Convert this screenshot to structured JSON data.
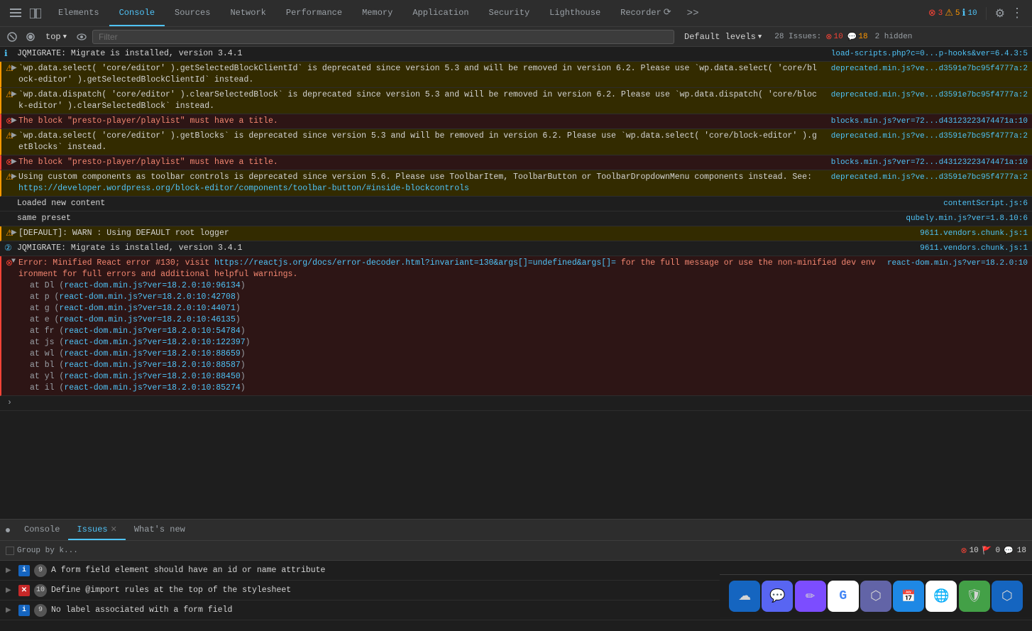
{
  "devtools": {
    "tabs": [
      {
        "id": "elements",
        "label": "Elements",
        "active": false
      },
      {
        "id": "console",
        "label": "Console",
        "active": true
      },
      {
        "id": "sources",
        "label": "Sources",
        "active": false
      },
      {
        "id": "network",
        "label": "Network",
        "active": false
      },
      {
        "id": "performance",
        "label": "Performance",
        "active": false
      },
      {
        "id": "memory",
        "label": "Memory",
        "active": false
      },
      {
        "id": "application",
        "label": "Application",
        "active": false
      },
      {
        "id": "security",
        "label": "Security",
        "active": false
      },
      {
        "id": "lighthouse",
        "label": "Lighthouse",
        "active": false
      },
      {
        "id": "recorder",
        "label": "Recorder",
        "active": false
      }
    ],
    "error_count": "3",
    "warn_count": "5",
    "info_count": "10"
  },
  "toolbar": {
    "top_label": "top",
    "filter_placeholder": "Filter",
    "default_levels": "Default levels",
    "issues_label": "28 Issues:",
    "issues_error": "10",
    "issues_warn": "18",
    "hidden": "2 hidden"
  },
  "console_entries": [
    {
      "id": "jq1",
      "type": "info",
      "message": "JQMIGRATE: Migrate is installed, version 3.4.1",
      "source": "load-scripts.php?c=0...p-hooks&ver=6.4.3:5"
    },
    {
      "id": "warn1",
      "type": "warning",
      "message": "`wp.data.select( 'core/editor' ).getSelectedBlockClientId` is deprecated since version 5.3 and will be removed in version 6.2. Please use `wp.data.select( 'core/block-editor' ).getSelectedBlockClientId` instead.",
      "source": "deprecated.min.js?ve...d3591e7bc95f4777a:2"
    },
    {
      "id": "warn2",
      "type": "warning",
      "message": "`wp.data.dispatch( 'core/editor' ).clearSelectedBlock` is deprecated since version 5.3 and will be removed in version 6.2. Please use `wp.data.dispatch( 'core/block-editor' ).clearSelectedBlock` instead.",
      "source": "deprecated.min.js?ve...d3591e7bc95f4777a:2"
    },
    {
      "id": "err1",
      "type": "error",
      "message": "The block \"presto-player/playlist\" must have a title.",
      "source": "blocks.min.js?ver=72...d43123223474471a:10"
    },
    {
      "id": "warn3",
      "type": "warning",
      "message": "`wp.data.select( 'core/editor' ).getBlocks` is deprecated since version 5.3 and will be removed in version 6.2. Please use `wp.data.select( 'core/block-editor' ).getBlocks` instead.",
      "source": "deprecated.min.js?ve...d3591e7bc95f4777a:2"
    },
    {
      "id": "err2",
      "type": "error",
      "message": "The block \"presto-player/playlist\" must have a title.",
      "source": "blocks.min.js?ver=72...d43123223474471a:10"
    },
    {
      "id": "warn4",
      "type": "warning",
      "message": "Using custom components as toolbar controls is deprecated since version 5.6. Please use ToolbarItem, ToolbarButton or ToolbarDropdownMenu components instead. See: https://developer.wordpress.org/block-editor/components/toolbar-button/#inside-blockcontrols",
      "source": "deprecated.min.js?ve...d3591e7bc95f4777a:2",
      "link": "https://developer.wordpress.org/block-editor/components/toolbar-button/#inside-blockcontrols"
    },
    {
      "id": "info1",
      "type": "info",
      "message": "Loaded new content",
      "source": "contentScript.js:6"
    },
    {
      "id": "info2",
      "type": "info",
      "message": "same preset",
      "source": "qubely.min.js?ver=1.8.10:6"
    },
    {
      "id": "warn5",
      "type": "warning",
      "message": "[DEFAULT]: WARN : Using DEFAULT root logger",
      "source": "9611.vendors.chunk.js:1"
    },
    {
      "id": "jq2",
      "type": "info",
      "message": "JQMIGRATE: Migrate is installed, version 3.4.1",
      "source": "9611.vendors.chunk.js:1",
      "count": 2
    },
    {
      "id": "err3",
      "type": "error",
      "message": "Error: Minified React error #130; visit https://reactjs.org/docs/error-decoder.html?invariant=130&args[]=undefined&args[]= for the full message or use the non-minified dev environment for full errors and additional helpful warnings.",
      "source": "react-dom.min.js?ver=18.2.0:10",
      "link": "https://reactjs.org/docs/error-decoder.html?invariant=130&args[]=undefined&args[]=",
      "stack": [
        {
          "fn": "Dl",
          "file": "react-dom.min.js?ver=18.2.0:10:96134"
        },
        {
          "fn": "p",
          "file": "react-dom.min.js?ver=18.2.0:10:42708"
        },
        {
          "fn": "g",
          "file": "react-dom.min.js?ver=18.2.0:10:44071"
        },
        {
          "fn": "e",
          "file": "react-dom.min.js?ver=18.2.0:10:46135"
        },
        {
          "fn": "fr",
          "file": "react-dom.min.js?ver=18.2.0:10:54784"
        },
        {
          "fn": "js",
          "file": "react-dom.min.js?ver=18.2.0:10:122397"
        },
        {
          "fn": "wl",
          "file": "react-dom.min.js?ver=18.2.0:10:88659"
        },
        {
          "fn": "bl",
          "file": "react-dom.min.js?ver=18.2.0:10:88587"
        },
        {
          "fn": "yl",
          "file": "react-dom.min.js?ver=18.2.0:10:88450"
        },
        {
          "fn": "il",
          "file": "react-dom.min.js?ver=18.2.0:10:85274"
        }
      ]
    }
  ],
  "bottom_tabs": [
    {
      "id": "console",
      "label": "Console",
      "active": false,
      "closable": false
    },
    {
      "id": "issues",
      "label": "Issues",
      "active": true,
      "closable": true
    },
    {
      "id": "whats-new",
      "label": "What's new",
      "active": false,
      "closable": false
    }
  ],
  "issues_panel": {
    "group_by_label": "Group by k...",
    "error_count": "10",
    "warn_count": "0",
    "info_count": "18",
    "items": [
      {
        "type": "info",
        "count": 9,
        "message": "A form field element should have an id or name attribute"
      },
      {
        "type": "error",
        "count": 10,
        "message": "Define @import rules at the top of the stylesheet"
      },
      {
        "type": "info",
        "count": 9,
        "message": "No label associated with a form field"
      }
    ]
  },
  "taskbar": {
    "icons": [
      {
        "name": "cloud-icon",
        "color": "#1565c0",
        "symbol": "☁"
      },
      {
        "name": "discord-icon",
        "color": "#5865f2",
        "symbol": "💬"
      },
      {
        "name": "pen-icon",
        "color": "#7c4dff",
        "symbol": "✏"
      },
      {
        "name": "google-icon",
        "color": "#4285f4",
        "symbol": "G"
      },
      {
        "name": "teams-icon",
        "color": "#6264a7",
        "symbol": "T"
      },
      {
        "name": "calendar-icon",
        "color": "#1e88e5",
        "symbol": "📅"
      },
      {
        "name": "chrome-icon",
        "color": "#4285f4",
        "symbol": "⬤"
      },
      {
        "name": "shield-icon",
        "color": "#43a047",
        "symbol": "🛡"
      },
      {
        "name": "bluetooth-icon",
        "color": "#1565c0",
        "symbol": "⬡"
      }
    ]
  }
}
